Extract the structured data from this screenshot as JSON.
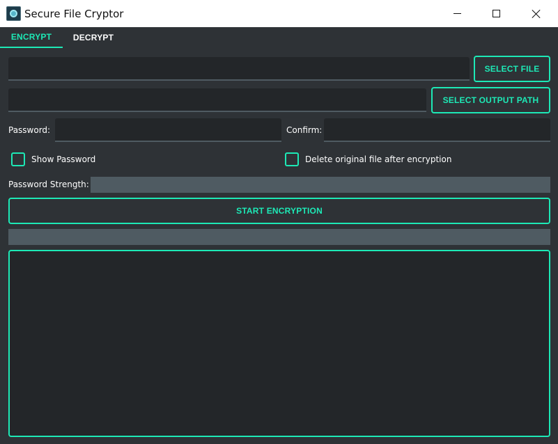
{
  "window": {
    "title": "Secure File Cryptor"
  },
  "tabs": [
    {
      "label": "ENCRYPT",
      "active": true
    },
    {
      "label": "DECRYPT",
      "active": false
    }
  ],
  "encrypt": {
    "input_file_value": "",
    "select_file_label": "SELECT FILE",
    "output_path_value": "",
    "select_output_label": "SELECT OUTPUT PATH",
    "password_label": "Password:",
    "password_value": "",
    "confirm_label": "Confirm:",
    "confirm_value": "",
    "show_password_label": "Show Password",
    "show_password_checked": false,
    "delete_original_label": "Delete original file after encryption",
    "delete_original_checked": false,
    "strength_label": "Password Strength:",
    "strength_level": 0,
    "start_label": "START ENCRYPTION",
    "progress_level": 0,
    "log_text": ""
  },
  "colors": {
    "accent": "#1de9b6",
    "background": "#2e3236",
    "field_background": "#232629",
    "track": "#4f5b62"
  }
}
